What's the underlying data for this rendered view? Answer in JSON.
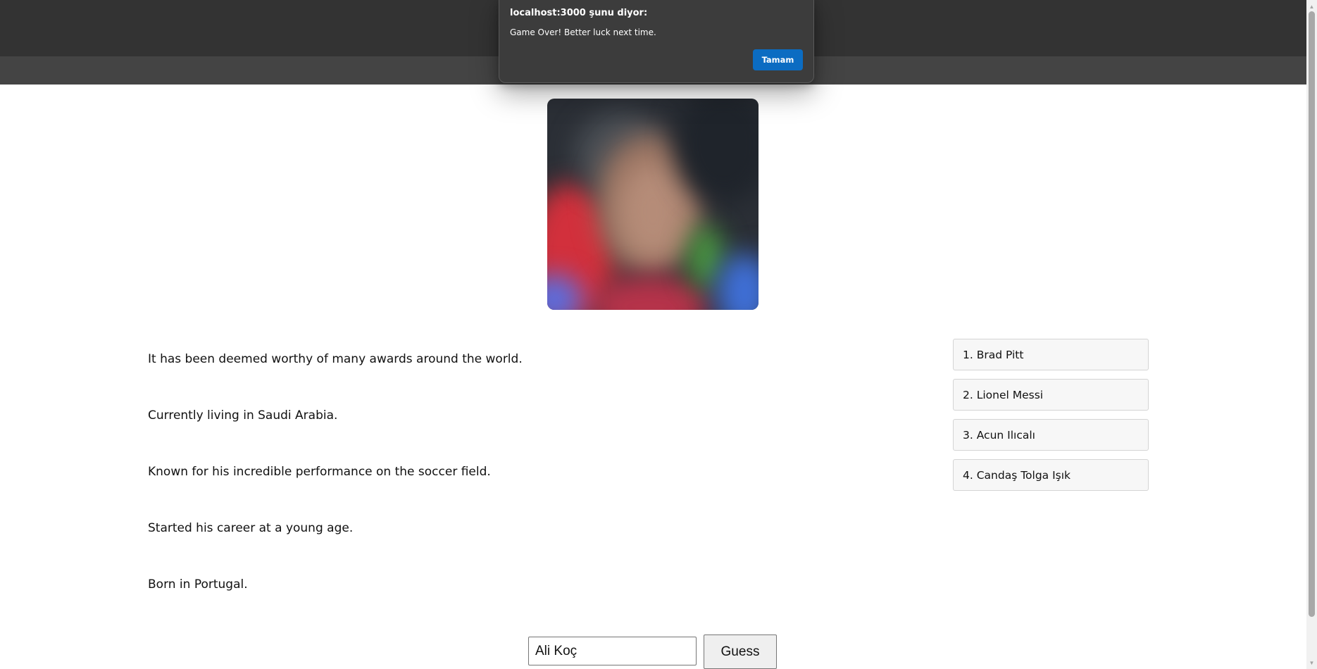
{
  "dialog": {
    "title": "localhost:3000 şunu diyor:",
    "message": "Game Over! Better luck next time.",
    "ok_label": "Tamam"
  },
  "clues": [
    "It has been deemed worthy of many awards around the world.",
    "Currently living in Saudi Arabia.",
    "Known for his incredible performance on the soccer field.",
    "Started his career at a young age.",
    "Born in Portugal."
  ],
  "options": [
    "1. Brad Pitt",
    "2. Lionel Messi",
    "3. Acun Ilıcalı",
    "4. Candaş Tolga Işık"
  ],
  "guess": {
    "input_value": "Ali Koç",
    "button_label": "Guess"
  },
  "colors": {
    "topbar": "#333333",
    "subbar": "#444444",
    "dialog_bg": "#3c3c3c",
    "dialog_button": "#0b6cc2"
  }
}
